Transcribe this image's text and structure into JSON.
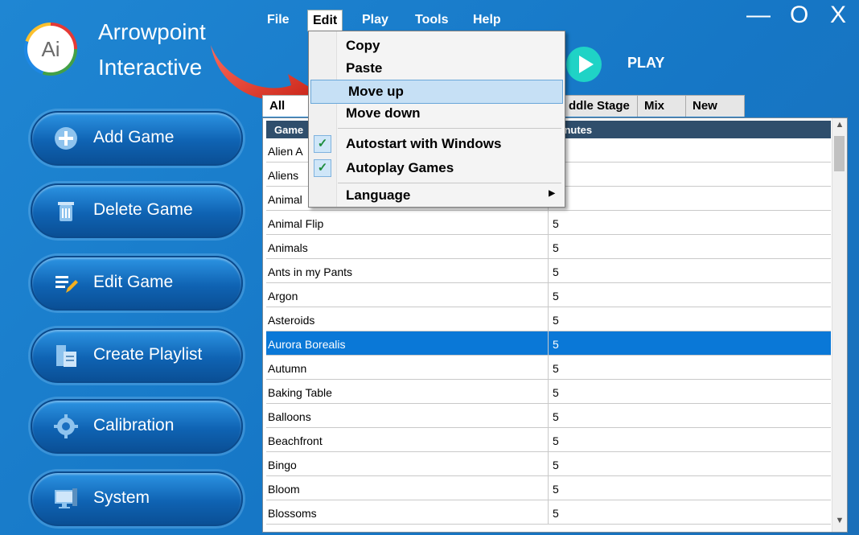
{
  "app": {
    "brand_line1": "Arrowpoint",
    "brand_line2": "Interactive",
    "logo_text": "Ai"
  },
  "sidebar": {
    "buttons": [
      {
        "label": "Add Game",
        "icon": "plus-circle-icon"
      },
      {
        "label": "Delete Game",
        "icon": "trash-icon"
      },
      {
        "label": "Edit Game",
        "icon": "edit-list-icon"
      },
      {
        "label": "Create Playlist",
        "icon": "playlist-icon"
      },
      {
        "label": "Calibration",
        "icon": "gear-icon"
      },
      {
        "label": "System",
        "icon": "monitor-icon"
      }
    ]
  },
  "menubar": {
    "items": [
      "File",
      "Edit",
      "Play",
      "Tools",
      "Help"
    ],
    "open": "Edit"
  },
  "window_controls": {
    "minimize": "—",
    "maximize": "O",
    "close": "X"
  },
  "play": {
    "label": "PLAY"
  },
  "tabs": [
    {
      "label": "All",
      "active": true
    },
    {
      "label": "ddle Stage"
    },
    {
      "label": "Mix"
    },
    {
      "label": "New"
    }
  ],
  "grid": {
    "columns": [
      "Game",
      "Minutes"
    ],
    "rows": [
      {
        "name": "Alien A",
        "minutes": ""
      },
      {
        "name": "Aliens",
        "minutes": ""
      },
      {
        "name": "Animal",
        "minutes": ""
      },
      {
        "name": "Animal Flip",
        "minutes": "5"
      },
      {
        "name": "Animals",
        "minutes": "5"
      },
      {
        "name": "Ants in my Pants",
        "minutes": "5"
      },
      {
        "name": "Argon",
        "minutes": "5"
      },
      {
        "name": "Asteroids",
        "minutes": "5"
      },
      {
        "name": "Aurora Borealis",
        "minutes": "5",
        "selected": true
      },
      {
        "name": "Autumn",
        "minutes": "5"
      },
      {
        "name": "Baking Table",
        "minutes": "5"
      },
      {
        "name": "Balloons",
        "minutes": "5"
      },
      {
        "name": "Beachfront",
        "minutes": "5"
      },
      {
        "name": "Bingo",
        "minutes": "5"
      },
      {
        "name": "Bloom",
        "minutes": "5"
      },
      {
        "name": "Blossoms",
        "minutes": "5"
      }
    ]
  },
  "edit_menu": {
    "copy": "Copy",
    "paste": "Paste",
    "move_up": "Move up",
    "move_down": "Move down",
    "autostart": "Autostart with Windows",
    "autoplay": "Autoplay Games",
    "language": "Language",
    "highlighted": "Move up",
    "colors": {
      "highlight": "#c6e0f5",
      "check": "#1d8d3c"
    }
  },
  "colors": {
    "background": "#1677c6",
    "header": "#2f4e6c",
    "selected_row": "#0a78d7",
    "play_accent": "#1fd3c6",
    "arrow": "#e53925"
  }
}
